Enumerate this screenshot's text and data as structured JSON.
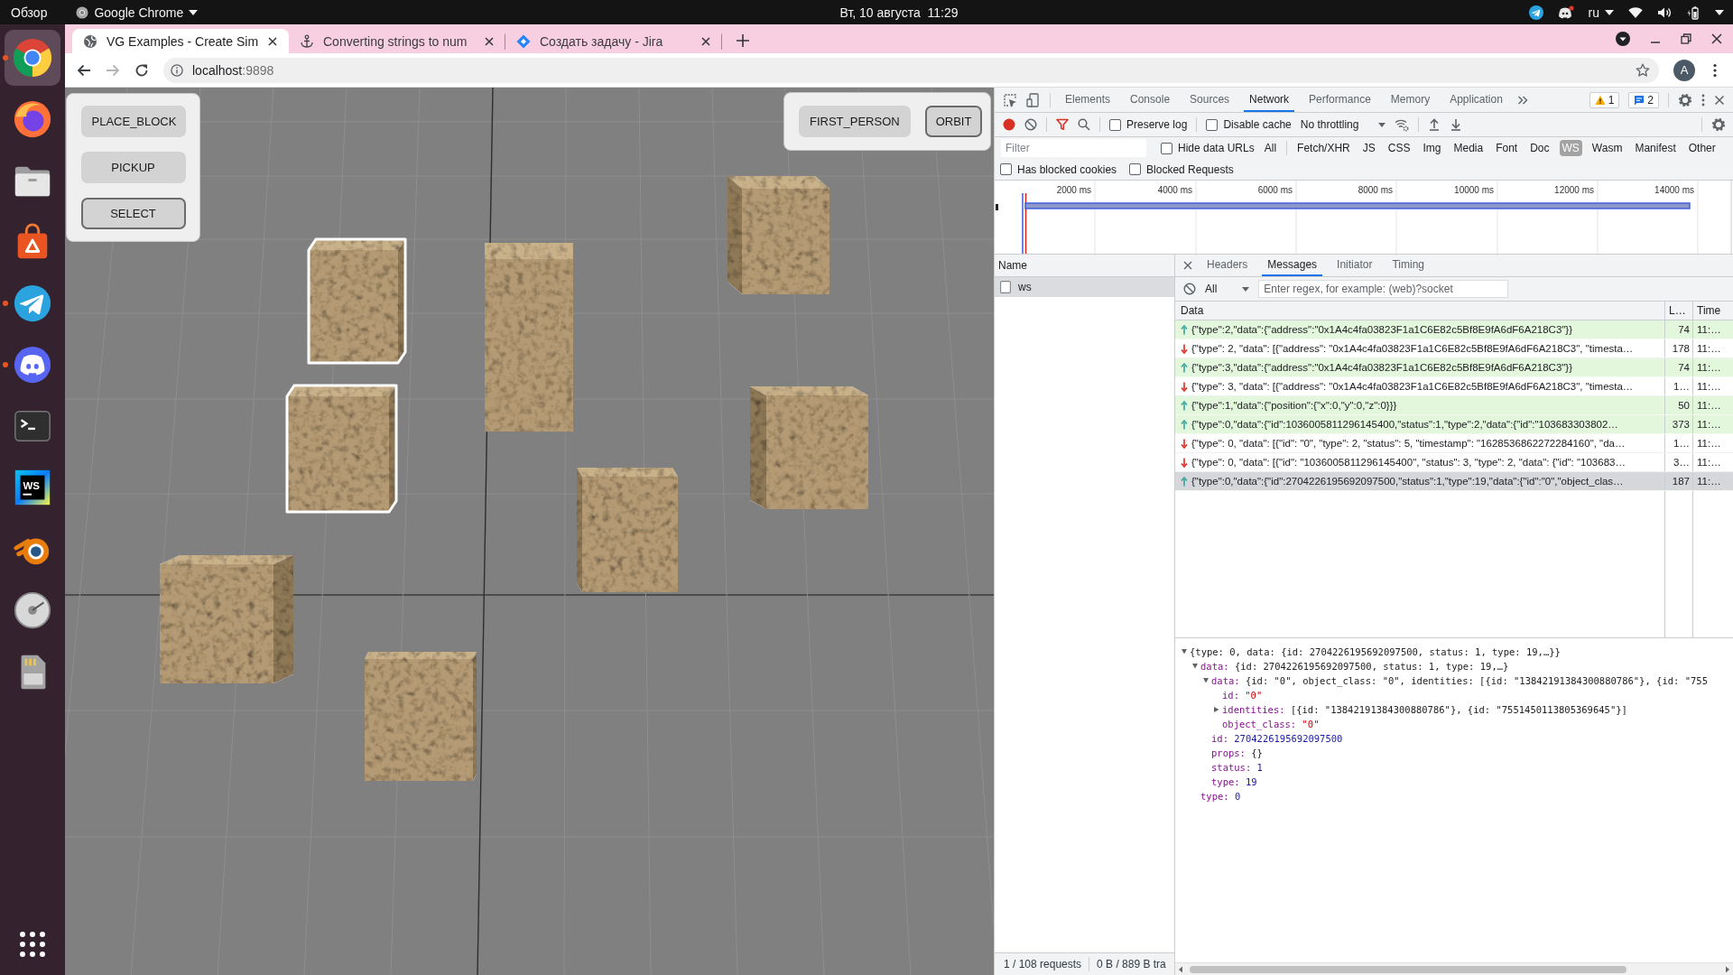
{
  "top_bar": {
    "activities": "Обзор",
    "app_name": "Google Chrome",
    "datetime": "Вт, 10 августа  11:29",
    "language": "ru"
  },
  "dock": {
    "items": [
      {
        "kind": "chrome",
        "selected": true,
        "running": true
      },
      {
        "kind": "firefox",
        "selected": false,
        "running": false
      },
      {
        "kind": "files",
        "selected": false,
        "running": false
      },
      {
        "kind": "software",
        "selected": false,
        "running": false
      },
      {
        "kind": "telegram",
        "selected": false,
        "running": true
      },
      {
        "kind": "discord",
        "selected": false,
        "running": true
      },
      {
        "kind": "terminal",
        "selected": false,
        "running": false
      },
      {
        "kind": "webstorm",
        "label": "WS",
        "selected": false,
        "running": false
      },
      {
        "kind": "blender",
        "selected": false,
        "running": false
      },
      {
        "kind": "disks",
        "selected": false,
        "running": false
      },
      {
        "kind": "sdcard",
        "selected": false,
        "running": false
      }
    ]
  },
  "browser": {
    "tabs": [
      {
        "kind": "globe",
        "title": "VG Examples - Create Sim",
        "selected": true
      },
      {
        "kind": "anchor",
        "title": "Converting strings to num",
        "selected": false
      },
      {
        "kind": "jira",
        "title": "Создать задачу - Jira",
        "selected": false
      }
    ],
    "nav_buttons": [
      {
        "kind": "back",
        "disabled": false
      },
      {
        "kind": "forward",
        "disabled": true
      },
      {
        "kind": "reload",
        "disabled": false
      }
    ],
    "address": {
      "host": "localhost",
      "port": ":9898"
    },
    "profile_initial": "A"
  },
  "page": {
    "tool_buttons": [
      {
        "label": "PLACE_BLOCK",
        "selected": false
      },
      {
        "label": "PICKUP",
        "selected": false
      },
      {
        "label": "SELECT",
        "selected": true
      }
    ],
    "camera_buttons": [
      {
        "label": "FIRST_PERSON",
        "selected": false
      },
      {
        "label": "ORBIT",
        "selected": true
      }
    ],
    "blocks": [
      {
        "selected": false
      },
      {
        "selected": true
      },
      {
        "selected": false
      },
      {
        "selected": true
      },
      {
        "selected": false
      },
      {
        "selected": false
      },
      {
        "selected": false
      },
      {
        "selected": false
      }
    ]
  },
  "devtools": {
    "tabs": [
      {
        "label": "Elements",
        "selected": false
      },
      {
        "label": "Console",
        "selected": false
      },
      {
        "label": "Sources",
        "selected": false
      },
      {
        "label": "Network",
        "selected": true
      },
      {
        "label": "Performance",
        "selected": false
      },
      {
        "label": "Memory",
        "selected": false
      },
      {
        "label": "Application",
        "selected": false
      }
    ],
    "warning_count": "1",
    "message_count": "2",
    "toolbar": {
      "recording": true,
      "options": [
        {
          "label": "Preserve log",
          "checked": false
        },
        {
          "label": "Disable cache",
          "checked": false
        }
      ],
      "throttling": "No throttling"
    },
    "filter": {
      "placeholder": "Filter",
      "options": [
        {
          "label": "Hide data URLs",
          "checked": false
        }
      ],
      "types": [
        {
          "label": "All",
          "selected": false
        },
        {
          "label": "Fetch/XHR",
          "selected": false
        },
        {
          "label": "JS",
          "selected": false
        },
        {
          "label": "CSS",
          "selected": false
        },
        {
          "label": "Img",
          "selected": false
        },
        {
          "label": "Media",
          "selected": false
        },
        {
          "label": "Font",
          "selected": false
        },
        {
          "label": "Doc",
          "selected": false
        },
        {
          "label": "WS",
          "selected": true
        },
        {
          "label": "Wasm",
          "selected": false
        },
        {
          "label": "Manifest",
          "selected": false
        },
        {
          "label": "Other",
          "selected": false
        }
      ]
    },
    "blocked_options": [
      {
        "label": "Has blocked cookies",
        "checked": false
      },
      {
        "label": "Blocked Requests",
        "checked": false
      }
    ],
    "overview": {
      "ticks": [
        "2000 ms",
        "4000 ms",
        "6000 ms",
        "8000 ms",
        "10000 ms",
        "12000 ms",
        "14000 ms"
      ]
    },
    "requests": {
      "header": "Name",
      "rows": [
        {
          "name": "ws",
          "selected": true
        }
      ]
    },
    "status": [
      "1 / 108 requests",
      "0 B / 889 B tra"
    ],
    "detail": {
      "tabs": [
        {
          "label": "Headers",
          "selected": false
        },
        {
          "label": "Messages",
          "selected": true
        },
        {
          "label": "Initiator",
          "selected": false
        },
        {
          "label": "Timing",
          "selected": false
        }
      ],
      "message_filter": {
        "type": "All",
        "placeholder": "Enter regex, for example: (web)?socket"
      },
      "columns": [
        "Data",
        "L…",
        "Time"
      ],
      "messages": [
        {
          "kind": "sent",
          "data": "{\"type\":2,\"data\":{\"address\":\"0x1A4c4fa03823F1a1C6E82c5Bf8E9fA6dF6A218C3\"}}",
          "length": "74",
          "time": "11:…",
          "selected": false
        },
        {
          "kind": "received",
          "data": "{\"type\": 2, \"data\": [{\"address\": \"0x1A4c4fa03823F1a1C6E82c5Bf8E9fA6dF6A218C3\", \"timesta…",
          "length": "178",
          "time": "11:…",
          "selected": false
        },
        {
          "kind": "sent",
          "data": "{\"type\":3,\"data\":{\"address\":\"0x1A4c4fa03823F1a1C6E82c5Bf8E9fA6dF6A218C3\"}}",
          "length": "74",
          "time": "11:…",
          "selected": false
        },
        {
          "kind": "received",
          "data": "{\"type\": 3, \"data\": [{\"address\": \"0x1A4c4fa03823F1a1C6E82c5Bf8E9fA6dF6A218C3\", \"timesta…",
          "length": "1…",
          "time": "11:…",
          "selected": false
        },
        {
          "kind": "sent",
          "data": "{\"type\":1,\"data\":{\"position\":{\"x\":0,\"y\":0,\"z\":0}}}",
          "length": "50",
          "time": "11:…",
          "selected": false
        },
        {
          "kind": "sent",
          "data": "{\"type\":0,\"data\":{\"id\":1036005811296145400,\"status\":1,\"type\":2,\"data\":{\"id\":\"103683303802…",
          "length": "373",
          "time": "11:…",
          "selected": false
        },
        {
          "kind": "received",
          "data": "{\"type\": 0, \"data\": [{\"id\": \"0\", \"type\": 2, \"status\": 5, \"timestamp\": \"1628536862272284160\", \"da…",
          "length": "1…",
          "time": "11:…",
          "selected": false
        },
        {
          "kind": "received",
          "data": "{\"type\": 0, \"data\": [{\"id\": \"1036005811296145400\", \"status\": 3, \"type\": 2, \"data\": {\"id\": \"103683…",
          "length": "3…",
          "time": "11:…",
          "selected": false
        },
        {
          "kind": "sent",
          "data": "{\"type\":0,\"data\":{\"id\":2704226195692097500,\"status\":1,\"type\":19,\"data\":{\"id\":\"0\",\"object_clas…",
          "length": "187",
          "time": "11:…",
          "selected": true
        }
      ],
      "preview": {
        "value": "{type: 0, data: {id: 2704226195692097500, status: 1, type: 19,…}}",
        "kind": "object",
        "expanded": true,
        "children": [
          {
            "key": "data:",
            "value": "{id: 2704226195692097500, status: 1, type: 19,…}",
            "kind": "object",
            "expanded": true,
            "children": [
              {
                "key": "data:",
                "value": "{id: \"0\", object_class: \"0\", identities: [{id: \"13842191384300880786\"}, {id: \"755",
                "kind": "object",
                "expanded": true,
                "children": [
                  {
                    "key": "id:",
                    "value": "\"0\"",
                    "kind": "string"
                  },
                  {
                    "key": "identities:",
                    "value": "[{id: \"13842191384300880786\"}, {id: \"7551450113805369645\"}]",
                    "kind": "object",
                    "expanded": false
                  },
                  {
                    "key": "object_class:",
                    "value": "\"0\"",
                    "kind": "string"
                  }
                ]
              },
              {
                "key": "id:",
                "value": "2704226195692097500",
                "kind": "number"
              },
              {
                "key": "props:",
                "value": "{}",
                "kind": "empty"
              },
              {
                "key": "status:",
                "value": "1",
                "kind": "number"
              },
              {
                "key": "type:",
                "value": "19",
                "kind": "number"
              }
            ]
          },
          {
            "key": "type:",
            "value": "0",
            "kind": "number"
          }
        ]
      }
    }
  }
}
